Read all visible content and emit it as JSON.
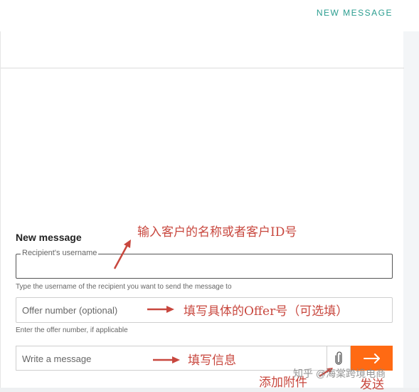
{
  "header": {
    "new_message_link": "NEW MESSAGE"
  },
  "form": {
    "title": "New message",
    "recipient_legend": "Recipient's username",
    "recipient_value": "",
    "recipient_hint": "Type the username of the recipient you want to send the message to",
    "offer_placeholder": "Offer number (optional)",
    "offer_hint": "Enter the offer number, if applicable",
    "message_placeholder": "Write a message",
    "send_icon": "arrow-right-icon",
    "attach_icon": "paperclip-icon"
  },
  "annotations": {
    "recipient": "输入客户的名称或者客户ID号",
    "offer": "填写具体的Offer号（可选填）",
    "message": "填写信息",
    "attach": "添加附件",
    "send": "发送"
  },
  "watermark": "知乎 @海棠跨境电商",
  "colors": {
    "accent": "#2a9d8f",
    "send_button": "#ff6a13",
    "annotation": "#c8473e"
  }
}
